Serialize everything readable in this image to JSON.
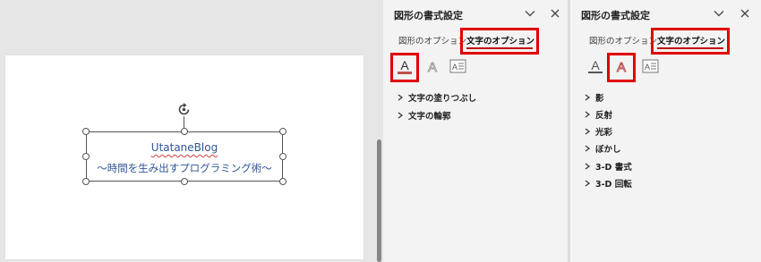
{
  "textbox": {
    "line1": "UtataneBlog",
    "line2": "〜時間を生み出すプログラミング術〜"
  },
  "pane1": {
    "title": "図形の書式設定",
    "tabs": [
      {
        "label": "図形のオプション",
        "active": false
      },
      {
        "label": "文字のオプション",
        "active": true
      }
    ],
    "icons": [
      "text-fill-outline-icon",
      "text-effects-icon",
      "textbox-layout-icon"
    ],
    "selected_icon": "text-fill-outline-icon",
    "items": [
      "文字の塗りつぶし",
      "文字の輪郭"
    ]
  },
  "pane2": {
    "title": "図形の書式設定",
    "tabs": [
      {
        "label": "図形のオプション",
        "active": false
      },
      {
        "label": "文字のオプション",
        "active": true
      }
    ],
    "icons": [
      "text-fill-outline-icon",
      "text-effects-icon",
      "textbox-layout-icon"
    ],
    "selected_icon": "text-effects-icon",
    "items": [
      "影",
      "反射",
      "光彩",
      "ぼかし",
      "3-D 書式",
      "3-D 回転"
    ]
  },
  "colors": {
    "highlight": "#e00000",
    "accent_text": "#2f5597",
    "pane_bg": "#f3f3f3"
  }
}
